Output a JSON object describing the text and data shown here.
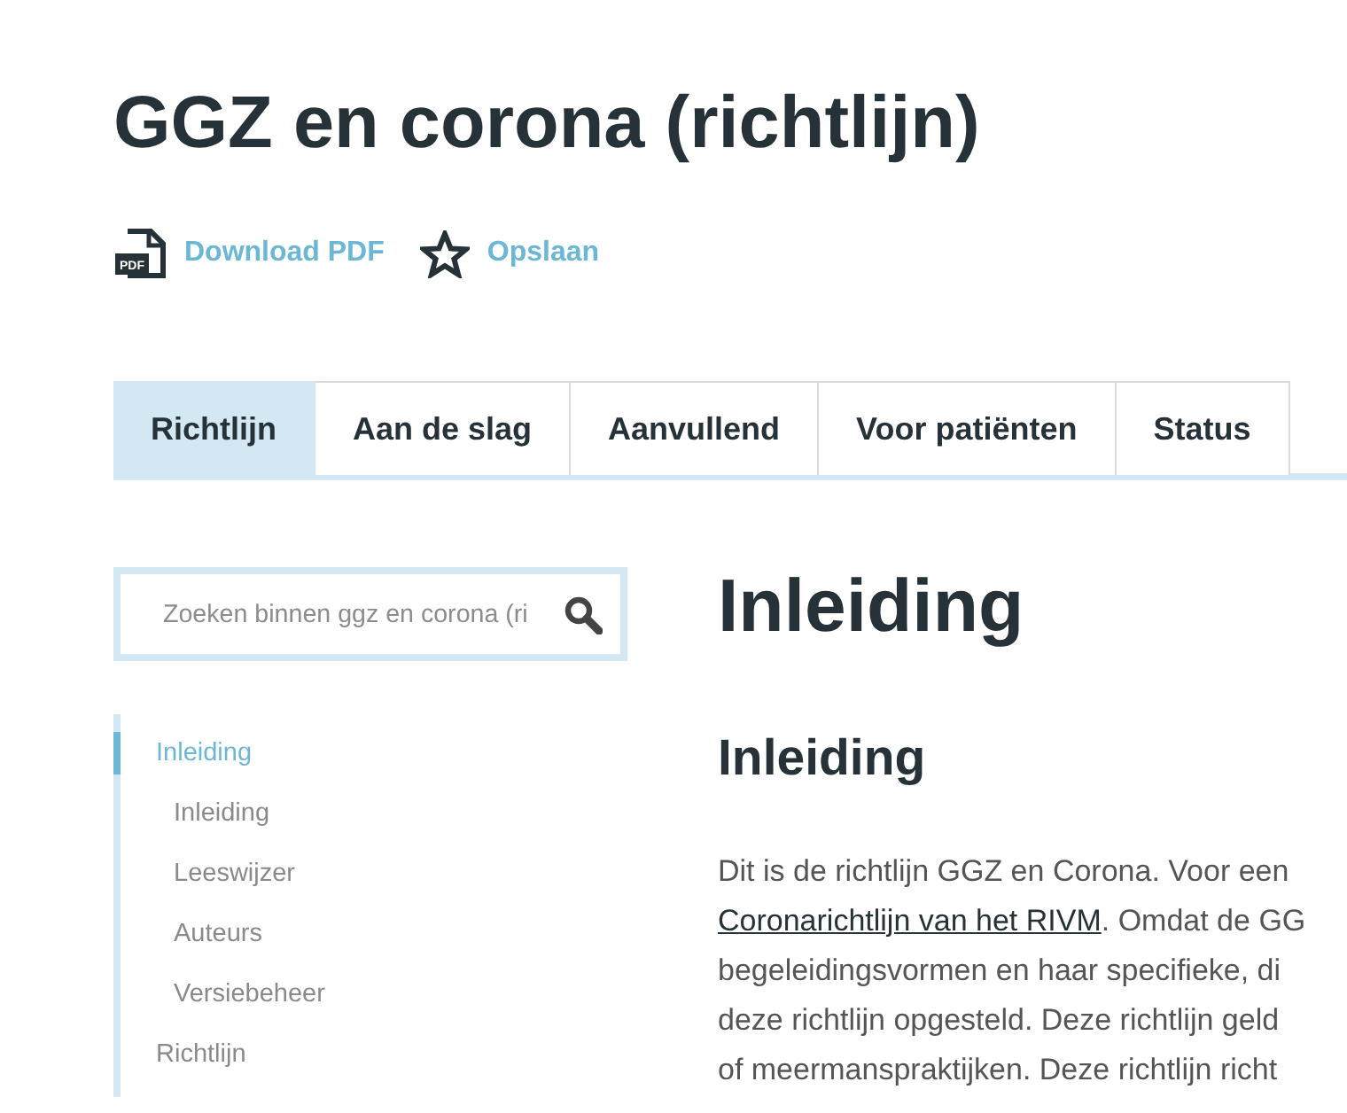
{
  "page": {
    "title": "GGZ en corona (richtlijn)"
  },
  "actions": [
    {
      "kind": "pdf",
      "label": "Download PDF",
      "icon_text": "PDF"
    },
    {
      "kind": "star",
      "label": "Opslaan"
    }
  ],
  "tabs": [
    {
      "label": "Richtlijn",
      "selected": true
    },
    {
      "label": "Aan de slag",
      "selected": false
    },
    {
      "label": "Aanvullend",
      "selected": false
    },
    {
      "label": "Voor patiënten",
      "selected": false
    },
    {
      "label": "Status",
      "selected": false
    }
  ],
  "search": {
    "placeholder": "Zoeken binnen ggz en corona (ri"
  },
  "sidebar": {
    "items": [
      {
        "label": "Inleiding",
        "selected": true,
        "children": [
          {
            "label": "Inleiding",
            "selected": false
          },
          {
            "label": "Leeswijzer",
            "selected": false
          },
          {
            "label": "Auteurs",
            "selected": false
          },
          {
            "label": "Versiebeheer",
            "selected": false
          }
        ]
      },
      {
        "label": "Richtlijn",
        "selected": false
      }
    ]
  },
  "content": {
    "heading": "Inleiding",
    "subheading": "Inleiding",
    "paragraph": {
      "lines": [
        [
          {
            "kind": "text",
            "text": "Dit is de richtlijn GGZ en Corona. Voor een"
          }
        ],
        [
          {
            "kind": "link",
            "text": "Coronarichtlijn van het RIVM"
          },
          {
            "kind": "text",
            "text": ". Omdat de GG"
          }
        ],
        [
          {
            "kind": "text",
            "text": "begeleidingsvormen en haar specifieke, di"
          }
        ],
        [
          {
            "kind": "text",
            "text": "deze richtlijn opgesteld. Deze richtlijn geld"
          }
        ],
        [
          {
            "kind": "text",
            "text": "of meermanspraktijken. Deze richtlijn richt"
          }
        ]
      ]
    }
  }
}
